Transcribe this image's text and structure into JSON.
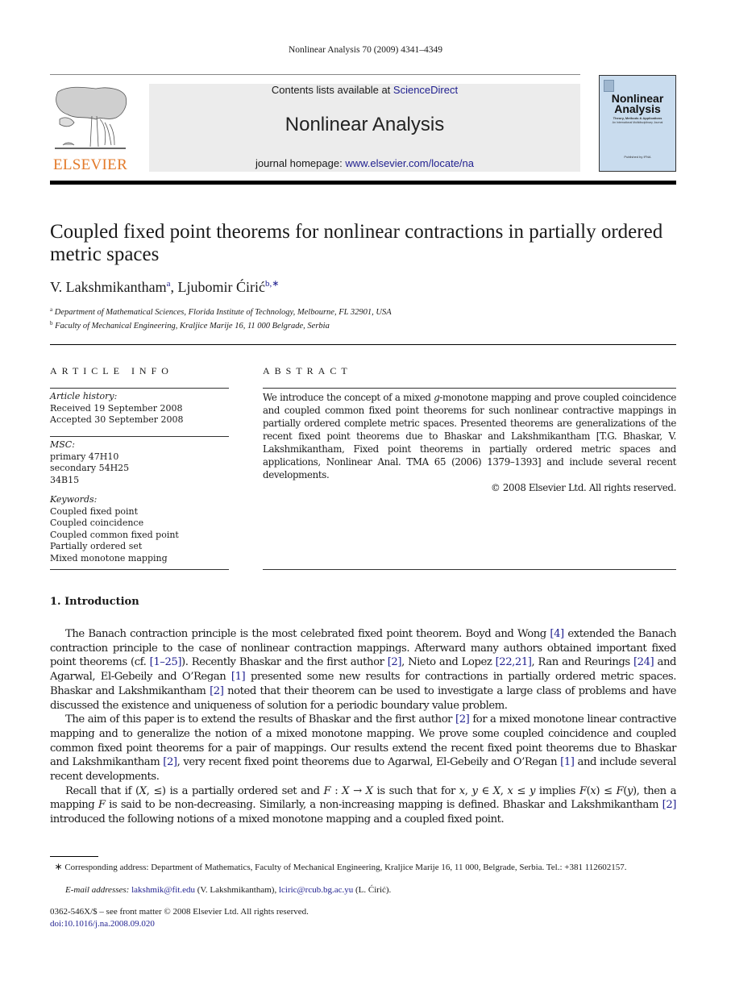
{
  "running_head": "Nonlinear Analysis 70 (2009) 4341–4349",
  "masthead": {
    "publisher_logo_text": "ELSEVIER",
    "contents_prefix": "Contents lists available at ",
    "contents_link": "ScienceDirect",
    "journal_name": "Nonlinear Analysis",
    "homepage_prefix": "journal homepage: ",
    "homepage_link": "www.elsevier.com/locate/na",
    "cover": {
      "title_line1": "Nonlinear",
      "title_line2": "Analysis",
      "subtitle": "Theory, Methods & Applications",
      "subtitle2": "An International Multidisciplinary Journal",
      "footer": "Published by IFNA"
    },
    "colors": {
      "elsevier_orange": "#e37a2a",
      "link_blue": "#1f1f8f",
      "masthead_bg": "#ececec",
      "cover_bg": "#c9dcee"
    }
  },
  "article": {
    "title": "Coupled fixed point theorems for nonlinear contractions in partially ordered metric spaces",
    "authors": [
      {
        "name": "V. Lakshmikantham",
        "marks": "a"
      },
      {
        "name": "Ljubomir Ćirić",
        "marks": "b,∗"
      }
    ],
    "author_separator": ", ",
    "affiliations": [
      {
        "mark": "a",
        "text": "Department of Mathematical Sciences, Florida Institute of Technology, Melbourne, FL 32901, USA"
      },
      {
        "mark": "b",
        "text": "Faculty of Mechanical Engineering, Kraljice Marije 16, 11 000 Belgrade, Serbia"
      }
    ]
  },
  "article_info": {
    "heading": "ARTICLE INFO",
    "history_label": "Article history:",
    "received": "Received 19 September 2008",
    "accepted": "Accepted 30 September 2008",
    "msc_label": "MSC:",
    "msc": [
      "primary 47H10",
      "secondary 54H25",
      "34B15"
    ],
    "keywords_label": "Keywords:",
    "keywords": [
      "Coupled fixed point",
      "Coupled coincidence",
      "Coupled common fixed point",
      "Partially ordered set",
      "Mixed monotone mapping"
    ]
  },
  "abstract": {
    "heading": "ABSTRACT",
    "text_1": "We introduce the concept of a mixed ",
    "g": "g",
    "text_2": "-monotone mapping and prove coupled coincidence and coupled common fixed point theorems for such nonlinear contractive mappings in partially ordered complete metric spaces. Presented theorems are generalizations of the recent fixed point theorems due to Bhaskar and Lakshmikantham [T.G. Bhaskar, V. Lakshmikantham, Fixed point theorems in partially ordered metric spaces and applications, Nonlinear Anal. TMA 65 (2006) 1379–1393] and include several recent developments.",
    "copyright": "© 2008 Elsevier Ltd. All rights reserved."
  },
  "introduction": {
    "heading": "1.  Introduction",
    "p1": [
      {
        "t": "The Banach contraction principle is the most celebrated fixed point theorem. Boyd and Wong "
      },
      {
        "r": "[4]"
      },
      {
        "t": " extended the Banach contraction principle to the case of nonlinear contraction mappings. Afterward many authors obtained important fixed point theorems (cf. "
      },
      {
        "r": "[1–25]"
      },
      {
        "t": "). Recently Bhaskar and the first author "
      },
      {
        "r": "[2]"
      },
      {
        "t": ", Nieto and Lopez "
      },
      {
        "r": "[22,21]"
      },
      {
        "t": ", Ran and Reurings "
      },
      {
        "r": "[24]"
      },
      {
        "t": " and Agarwal, El-Gebeily and O’Regan "
      },
      {
        "r": "[1]"
      },
      {
        "t": " presented some new results for contractions in partially ordered metric spaces. Bhaskar and Lakshmikantham "
      },
      {
        "r": "[2]"
      },
      {
        "t": " noted that their theorem can be used to investigate a large class of problems and have discussed the existence and uniqueness of solution for a periodic boundary value problem."
      }
    ],
    "p2": [
      {
        "t": "The aim of this paper is to extend the results of Bhaskar and the first author "
      },
      {
        "r": "[2]"
      },
      {
        "t": " for a mixed monotone linear contractive mapping and to generalize the notion of a mixed monotone mapping. We prove some coupled coincidence and coupled common fixed point theorems for a pair of mappings. Our results extend the recent fixed point theorems due to Bhaskar and Lakshmikantham "
      },
      {
        "r": "[2]"
      },
      {
        "t": ", very recent fixed point theorems due to Agarwal, El-Gebeily and O’Regan "
      },
      {
        "r": "[1]"
      },
      {
        "t": " and include several recent developments."
      }
    ],
    "p3": [
      {
        "t": "Recall that if ("
      },
      {
        "m": "X"
      },
      {
        "t": ", ≤) is a partially ordered set and "
      },
      {
        "m": "F"
      },
      {
        "t": " : "
      },
      {
        "m": "X"
      },
      {
        "t": " → "
      },
      {
        "m": "X"
      },
      {
        "t": " is such that for "
      },
      {
        "m": "x"
      },
      {
        "t": ", "
      },
      {
        "m": "y"
      },
      {
        "t": " ∈ "
      },
      {
        "m": "X"
      },
      {
        "t": ", "
      },
      {
        "m": "x"
      },
      {
        "t": " ≤ "
      },
      {
        "m": "y"
      },
      {
        "t": " implies "
      },
      {
        "m": "F"
      },
      {
        "t": "("
      },
      {
        "m": "x"
      },
      {
        "t": ") ≤ "
      },
      {
        "m": "F"
      },
      {
        "t": "("
      },
      {
        "m": "y"
      },
      {
        "t": "), then a mapping "
      },
      {
        "m": "F"
      },
      {
        "t": " is said to be non-decreasing. Similarly, a non-increasing mapping is defined. Bhaskar and Lakshmikantham "
      },
      {
        "r": "[2]"
      },
      {
        "t": " introduced the following notions of a mixed monotone mapping and a coupled fixed point."
      }
    ]
  },
  "footnotes": {
    "star": "∗",
    "corresponding": " Corresponding address: Department of Mathematics, Faculty of Mechanical Engineering, Kraljice Marije 16, 11 000, Belgrade, Serbia. Tel.: +381 112602157.",
    "email_label": "E-mail addresses: ",
    "emails": [
      {
        "address": "lakshmik@fit.edu",
        "owner": " (V. Lakshmikantham), "
      },
      {
        "address": "lciric@rcub.bg.ac.yu",
        "owner": " (L. Ćirić)."
      }
    ]
  },
  "issn_line": "0362-546X/$ – see front matter © 2008 Elsevier Ltd. All rights reserved.",
  "doi": "doi:10.1016/j.na.2008.09.020"
}
